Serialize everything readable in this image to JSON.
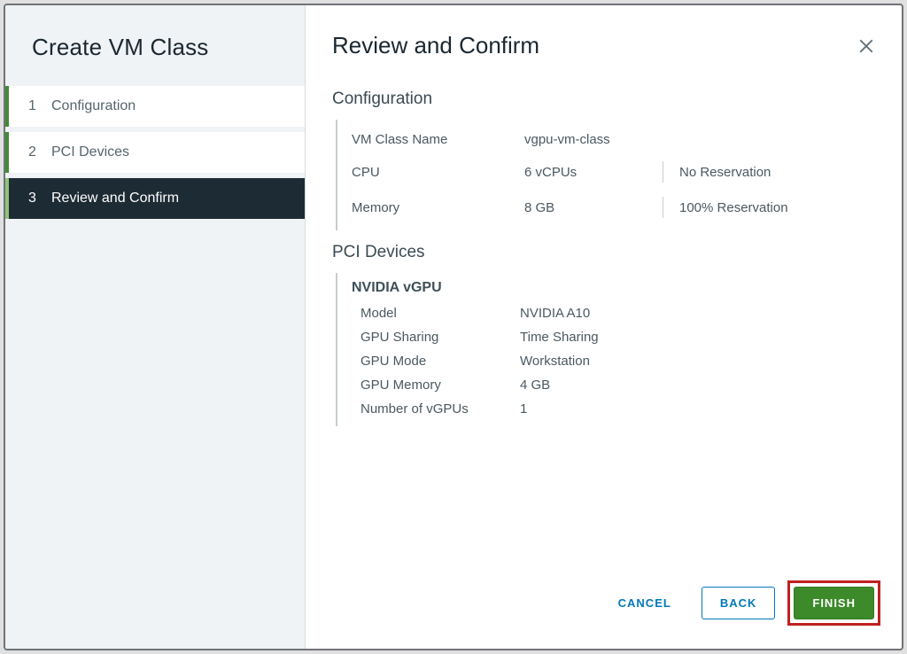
{
  "sidebar": {
    "title": "Create VM Class",
    "steps": [
      {
        "num": "1",
        "label": "Configuration",
        "state": "done"
      },
      {
        "num": "2",
        "label": "PCI Devices",
        "state": "done"
      },
      {
        "num": "3",
        "label": "Review and Confirm",
        "state": "active"
      }
    ]
  },
  "main": {
    "title": "Review and Confirm",
    "sections": {
      "configuration": {
        "heading": "Configuration",
        "rows": {
          "name": {
            "label": "VM Class Name",
            "value": "vgpu-vm-class",
            "extra": ""
          },
          "cpu": {
            "label": "CPU",
            "value": "6 vCPUs",
            "extra": "No Reservation"
          },
          "memory": {
            "label": "Memory",
            "value": "8 GB",
            "extra": "100% Reservation"
          }
        }
      },
      "pci": {
        "heading": "PCI Devices",
        "group_name": "NVIDIA vGPU",
        "rows": {
          "model": {
            "label": "Model",
            "value": "NVIDIA A10"
          },
          "sharing": {
            "label": "GPU Sharing",
            "value": "Time Sharing"
          },
          "mode": {
            "label": "GPU Mode",
            "value": "Workstation"
          },
          "memory": {
            "label": "GPU Memory",
            "value": "4 GB"
          },
          "count": {
            "label": "Number of vGPUs",
            "value": "1"
          }
        }
      }
    }
  },
  "footer": {
    "cancel": "CANCEL",
    "back": "BACK",
    "finish": "FINISH"
  }
}
